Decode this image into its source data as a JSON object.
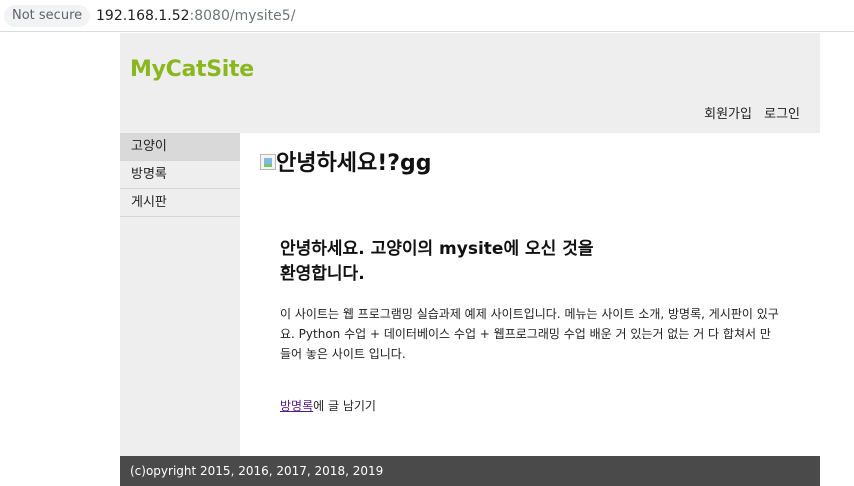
{
  "browser": {
    "security_label": "Not secure",
    "url_host": "192.168.1.52",
    "url_rest": ":8080/mysite5/"
  },
  "site": {
    "logo": "MyCatSite",
    "header_links": [
      "회원가입",
      "로그인"
    ],
    "nav": [
      "고양이",
      "방명록",
      "게시판"
    ],
    "active_nav": "고양이"
  },
  "main": {
    "hero_image_alt": "안녕하세요!?gg",
    "welcome_title": "안녕하세요. 고양이의 mysite에 오신 것을 환영합니다.",
    "intro_text": "이 사이트는 웹 프로그램밍 실습과제 예제 사이트입니다. 메뉴는 사이트 소개, 방명록, 게시판이 있구요. Python 수업 + 데이터베이스 수업 + 웹프로그래밍 수업 배운 거 있는거 없는 거 다 합쳐서 만들어 놓은 사이트 입니다.",
    "guestbook_link": "방명록",
    "guestbook_suffix": "에 글 남기기"
  },
  "footer": {
    "copyright": "(c)opyright 2015, 2016, 2017, 2018, 2019"
  },
  "colors": {
    "logo": "#8ab61e",
    "header_bg": "#eeeeee",
    "footer_bg": "#4a4a4a",
    "visited_link": "#551a8b"
  }
}
